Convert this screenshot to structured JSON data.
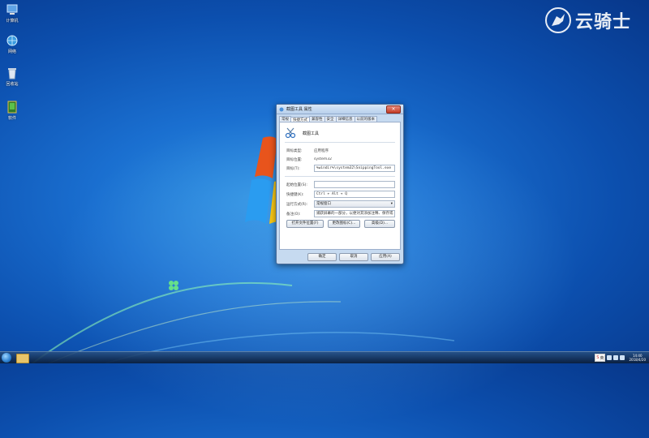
{
  "desktop": {
    "icons": [
      {
        "label": "计算机",
        "icon": "computer-icon"
      },
      {
        "label": "网络",
        "icon": "network-icon"
      },
      {
        "label": "回收站",
        "icon": "recycle-bin-icon"
      },
      {
        "label": "软件",
        "icon": "software-icon"
      }
    ],
    "watermark": "云骑士"
  },
  "dialog": {
    "title": "截图工具 属性",
    "tabs": [
      "常规",
      "快捷方式",
      "兼容性",
      "安全",
      "详细信息",
      "以前的版本"
    ],
    "app_name": "截图工具",
    "fields": {
      "target_type_label": "目标类型:",
      "target_type_value": "应用程序",
      "target_location_label": "目标位置:",
      "target_location_value": "system32",
      "target_label": "目标(T):",
      "target_value": "%windir%\\system32\\SnippingTool.exe",
      "start_in_label": "起始位置(S):",
      "start_in_value": "",
      "shortcut_key_label": "快捷键(K):",
      "shortcut_key_value": "Ctrl + Alt + Q",
      "run_label": "运行方式(R):",
      "run_value": "常规窗口",
      "comment_label": "备注(O):",
      "comment_value": "捕获屏幕的一部分，以便对其添加注释、保存或"
    },
    "buttons": {
      "open_location": "打开文件位置(F)",
      "change_icon": "更改图标(C)...",
      "advanced": "高级(D)..."
    },
    "footer": {
      "ok": "确定",
      "cancel": "取消",
      "apply": "应用(A)"
    }
  },
  "taskbar": {
    "ime_label": "S",
    "ime_mode": "英",
    "clock_time": "14:40",
    "clock_date": "2018/4/20"
  }
}
